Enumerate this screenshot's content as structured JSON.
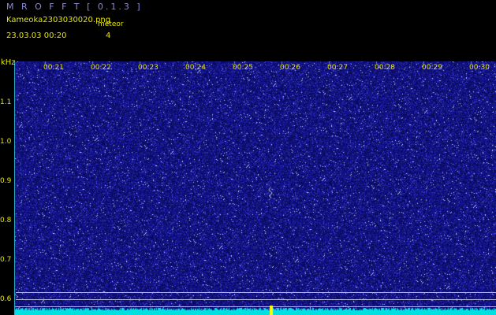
{
  "header": {
    "app_title": "M R O F F T  [ 0.1.3 ]",
    "file_name": "Kameoka2303030020.png",
    "detection_label": "meteor",
    "datetime": "23.03.03 00:20",
    "detection_count": "4"
  },
  "axis": {
    "unit_label": "kHz",
    "frequency_ticks": [
      "1.1",
      "1.0",
      "0.9",
      "0.8",
      "0.7",
      "0.6"
    ],
    "time_ticks": [
      "00:21",
      "00:22",
      "00:23",
      "00:24",
      "00:25",
      "00:26",
      "00:27",
      "00:28",
      "00:29",
      "00:30"
    ]
  },
  "colors": {
    "background": "#000000",
    "spectrogram_base": "#0a0a5a",
    "noise": "#2a2ae0",
    "text": "#e6e600",
    "title": "#8a8ad8",
    "trace": "#00e0e0",
    "meteor_marker": "#ffff00"
  }
}
